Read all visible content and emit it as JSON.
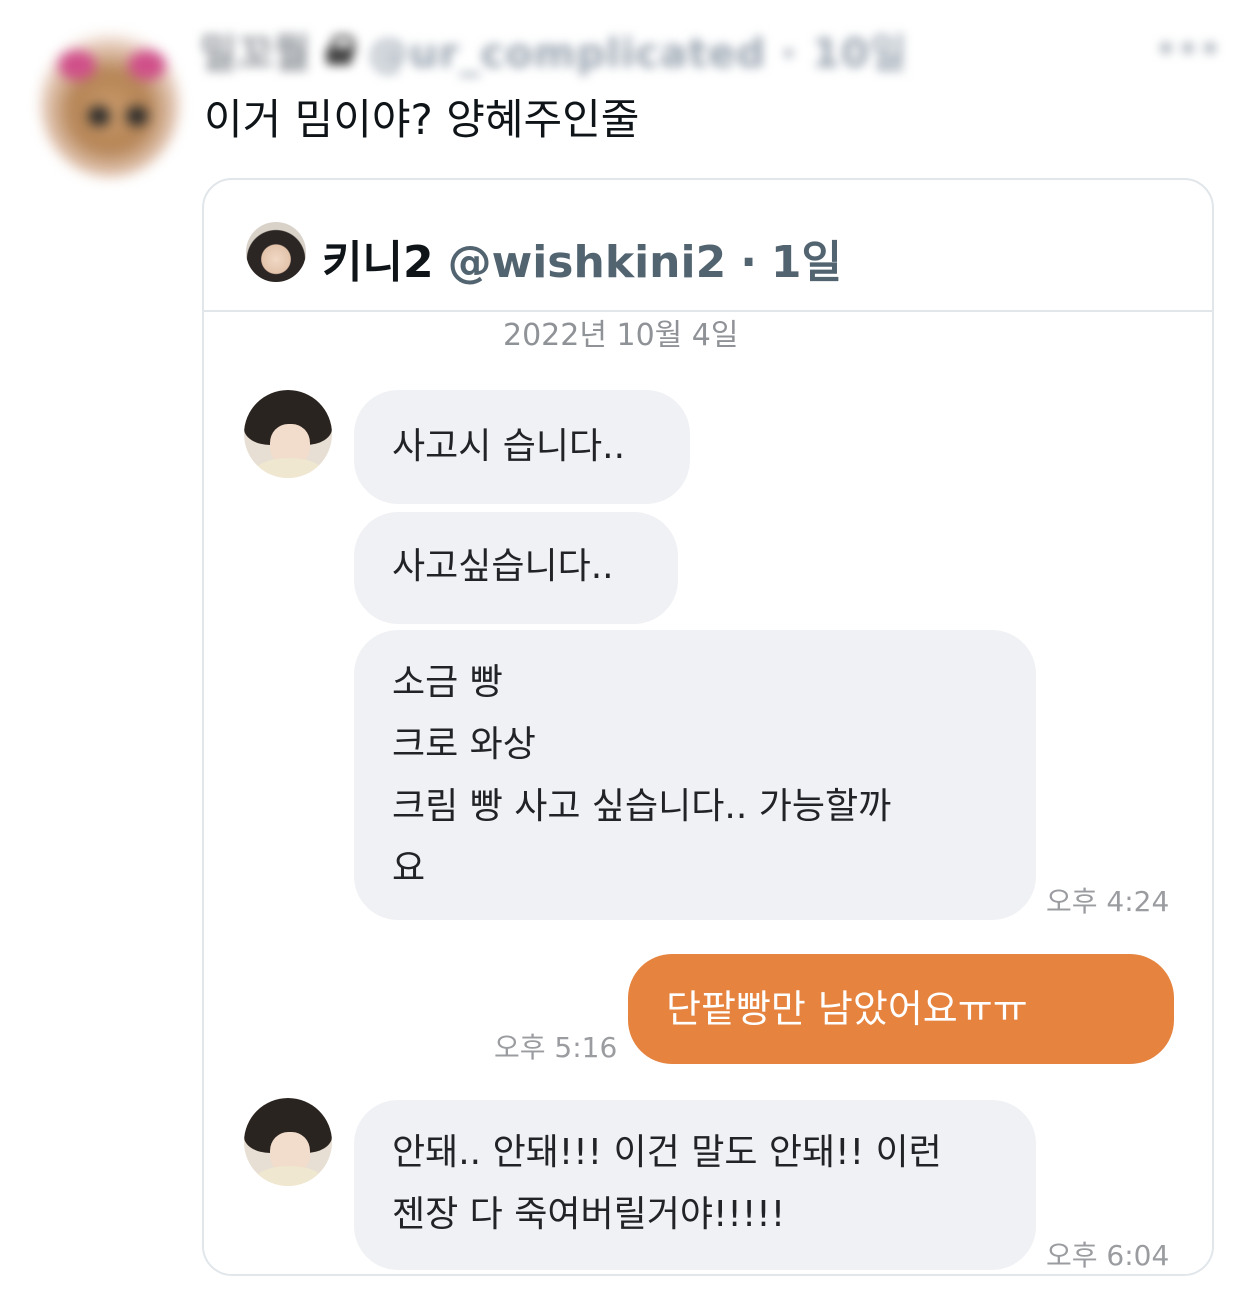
{
  "tweet": {
    "display_name": "밀꼬뭘",
    "handle": "@ur_complicated · 10일",
    "text": "이거 밈이야? 양혜주인줄"
  },
  "quoted_tweet": {
    "name": "키니2",
    "handle": "@wishkini2",
    "dot": "·",
    "time": "1일"
  },
  "chat": {
    "date": "2022년 10월 4일",
    "messages": [
      {
        "side": "in",
        "lines": [
          "사고시 습니다.."
        ]
      },
      {
        "side": "in",
        "lines": [
          "사고싶습니다.."
        ]
      },
      {
        "side": "in",
        "lines": [
          "소금 빵",
          "크로 와상",
          "크림 빵 사고 싶습니다.. 가능할까",
          "요"
        ],
        "time": "오후 4:24"
      },
      {
        "side": "out",
        "lines": [
          "단팥빵만 남았어요ㅠㅠ"
        ],
        "time": "오후 5:16"
      },
      {
        "side": "in",
        "lines": [
          "안돼.. 안돼!!! 이건 말도 안돼!! 이런",
          "젠장 다 죽여버릴거야!!!!!"
        ],
        "time": "오후 6:04"
      }
    ]
  },
  "colors": {
    "outgoing_bubble": "#e5833f",
    "incoming_bubble": "#f0f1f4",
    "secondary_text": "#536471"
  }
}
